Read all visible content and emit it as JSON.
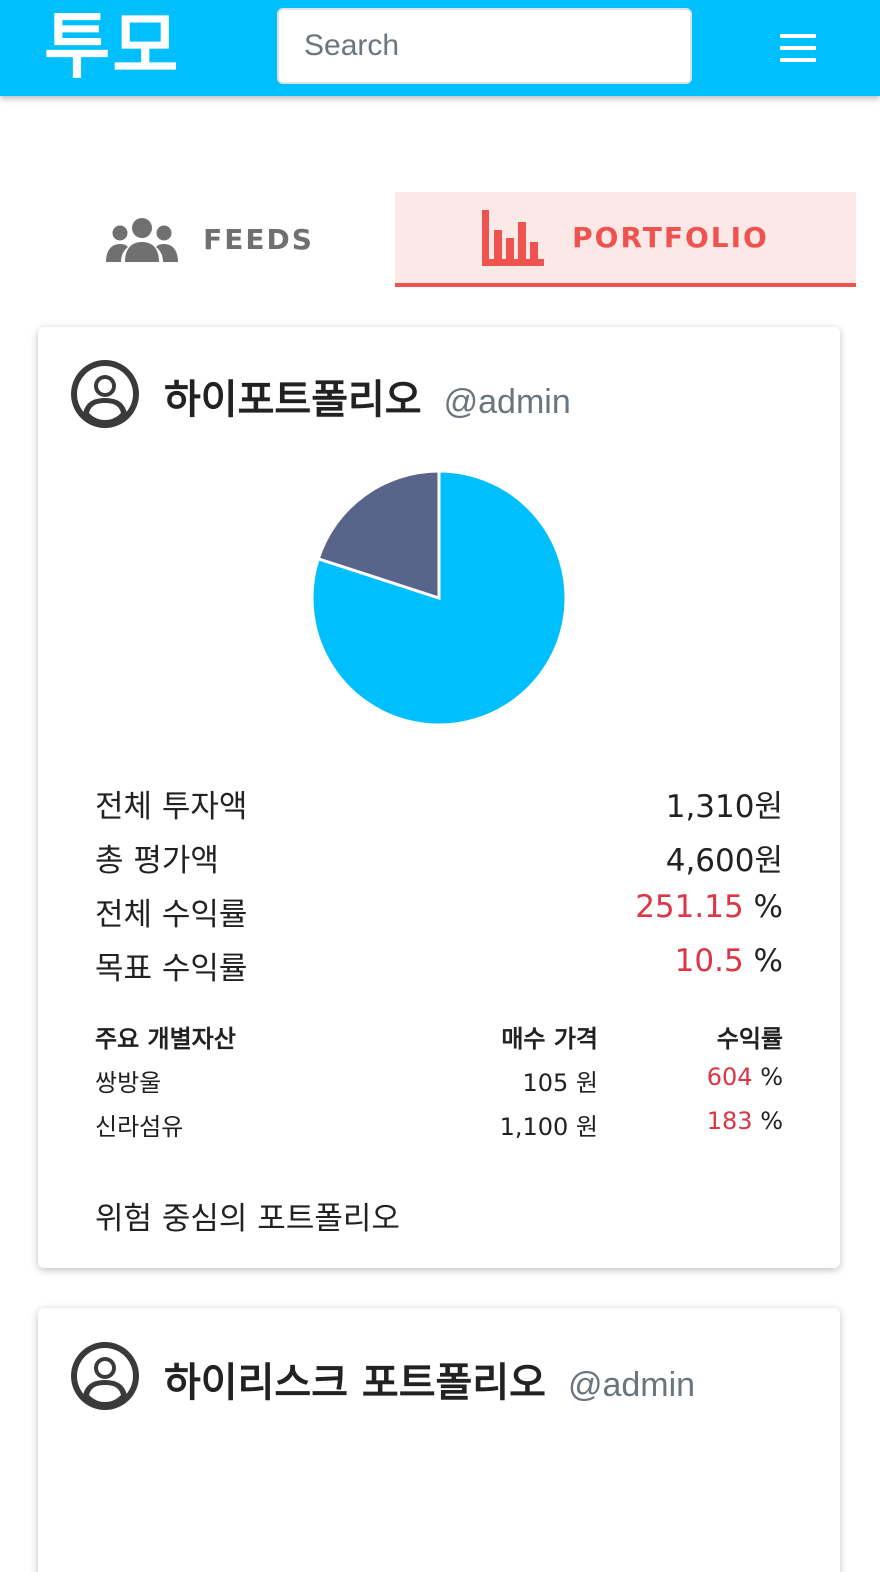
{
  "header": {
    "logo": "투모",
    "search_placeholder": "Search",
    "menu_icon": "hamburger-icon",
    "bg_color": "#00bfff"
  },
  "tabs": [
    {
      "label": "FEEDS",
      "icon": "users-icon",
      "active": false
    },
    {
      "label": "PORTFOLIO",
      "icon": "bar-chart-icon",
      "active": true
    }
  ],
  "accent_color": "#ef5350",
  "cards": [
    {
      "title": "하이포트폴리오",
      "user": "@admin",
      "chart_data": {
        "type": "pie",
        "slices": [
          {
            "value": 80,
            "color": "#00bfff"
          },
          {
            "value": 20,
            "color": "#58648a"
          }
        ]
      },
      "stats": [
        {
          "label": "전체 투자액",
          "value": "1,310원",
          "highlight": "",
          "unit": ""
        },
        {
          "label": "총 평가액",
          "value": "4,600원",
          "highlight": "",
          "unit": ""
        },
        {
          "label": "전체 수익률",
          "value": "",
          "highlight": "251.15",
          "unit": " %"
        },
        {
          "label": "목표 수익률",
          "value": "",
          "highlight": "10.5",
          "unit": " %"
        }
      ],
      "assets_header": {
        "name": "주요 개별자산",
        "price": "매수 가격",
        "return": "수익률"
      },
      "assets": [
        {
          "name": "쌍방울",
          "price": "105 원",
          "return": "604",
          "unit": " %"
        },
        {
          "name": "신라섬유",
          "price": "1,100 원",
          "return": "183",
          "unit": " %"
        }
      ],
      "description": "위험 중심의 포트폴리오"
    },
    {
      "title": "하이리스크 포트폴리오",
      "user": "@admin"
    }
  ]
}
